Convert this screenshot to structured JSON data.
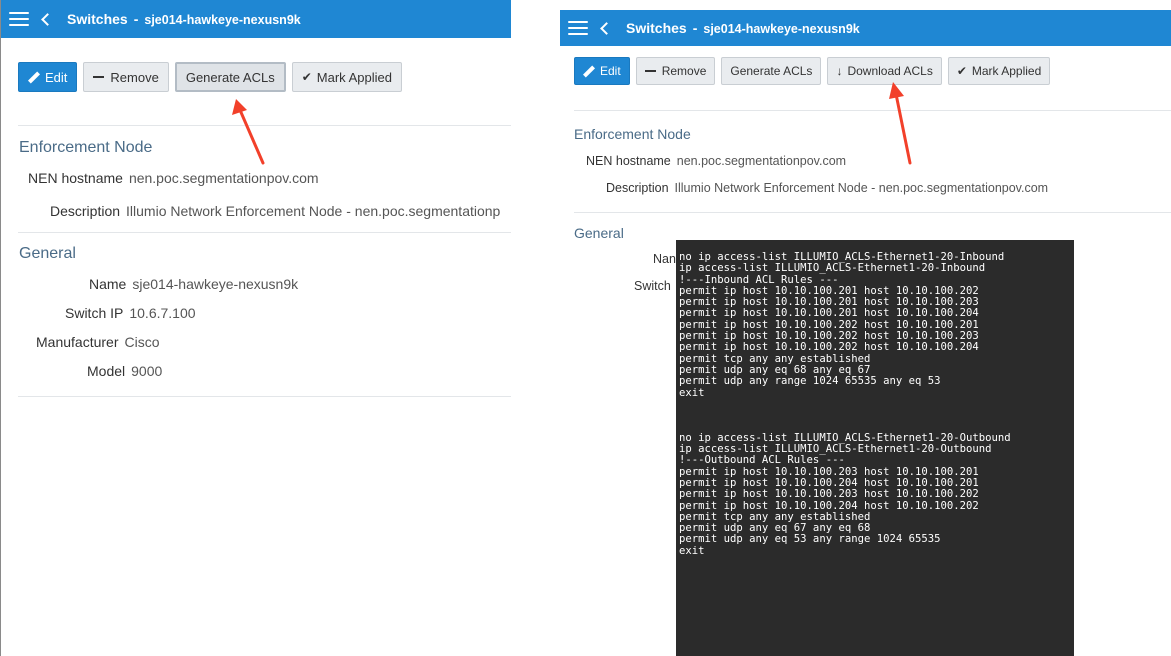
{
  "left": {
    "header": {
      "title": "Switches",
      "separator": "-",
      "subtitle": "sje014-hawkeye-nexusn9k"
    },
    "toolbar": {
      "edit": "Edit",
      "remove": "Remove",
      "generate": "Generate ACLs",
      "mark": "Mark Applied"
    },
    "enforcement": {
      "title": "Enforcement Node",
      "hostname_label": "NEN hostname",
      "hostname_value": "nen.poc.segmentationpov.com",
      "description_label": "Description",
      "description_value": "Illumio Network Enforcement Node - nen.poc.segmentationp"
    },
    "general": {
      "title": "General",
      "name_label": "Name",
      "name_value": "sje014-hawkeye-nexusn9k",
      "ip_label": "Switch IP",
      "ip_value": "10.6.7.100",
      "manufacturer_label": "Manufacturer",
      "manufacturer_value": "Cisco",
      "model_label": "Model",
      "model_value": "9000"
    }
  },
  "right": {
    "header": {
      "title": "Switches",
      "separator": "-",
      "subtitle": "sje014-hawkeye-nexusn9k"
    },
    "toolbar": {
      "edit": "Edit",
      "remove": "Remove",
      "generate": "Generate ACLs",
      "download": "Download ACLs",
      "mark": "Mark Applied"
    },
    "enforcement": {
      "title": "Enforcement Node",
      "hostname_label": "NEN hostname",
      "hostname_value": "nen.poc.segmentationpov.com",
      "description_label": "Description",
      "description_value": "Illumio Network Enforcement Node - nen.poc.segmentationpov.com"
    },
    "general": {
      "title": "General",
      "name_label_partial": "Nan",
      "switch_label_partial": "Switch"
    }
  },
  "terminal": {
    "lines": [
      "no ip access-list ILLUMIO_ACLS-Ethernet1-20-Inbound",
      "ip access-list ILLUMIO_ACLS-Ethernet1-20-Inbound",
      "!---Inbound ACL Rules ---",
      "permit ip host 10.10.100.201 host 10.10.100.202",
      "permit ip host 10.10.100.201 host 10.10.100.203",
      "permit ip host 10.10.100.201 host 10.10.100.204",
      "permit ip host 10.10.100.202 host 10.10.100.201",
      "permit ip host 10.10.100.202 host 10.10.100.203",
      "permit ip host 10.10.100.202 host 10.10.100.204",
      "permit tcp any any established",
      "permit udp any eq 68 any eq 67",
      "permit udp any range 1024 65535 any eq 53",
      "exit",
      "",
      "",
      "",
      "no ip access-list ILLUMIO_ACLS-Ethernet1-20-Outbound",
      "ip access-list ILLUMIO_ACLS-Ethernet1-20-Outbound",
      "!---Outbound ACL Rules ---",
      "permit ip host 10.10.100.203 host 10.10.100.201",
      "permit ip host 10.10.100.204 host 10.10.100.201",
      "permit ip host 10.10.100.203 host 10.10.100.202",
      "permit ip host 10.10.100.204 host 10.10.100.202",
      "permit tcp any any established",
      "permit udp any eq 67 any eq 68",
      "permit udp any eq 53 any range 1024 65535",
      "exit"
    ]
  },
  "colors": {
    "brand": "#1f87d3",
    "annotation": "#f2402a",
    "terminal_bg": "#2b2b2b"
  },
  "icons": {
    "menu": "hamburger-icon",
    "back": "chevron-left-icon",
    "edit": "pencil-icon",
    "remove": "minus-icon",
    "mark": "check-icon",
    "download": "arrow-down-icon"
  }
}
